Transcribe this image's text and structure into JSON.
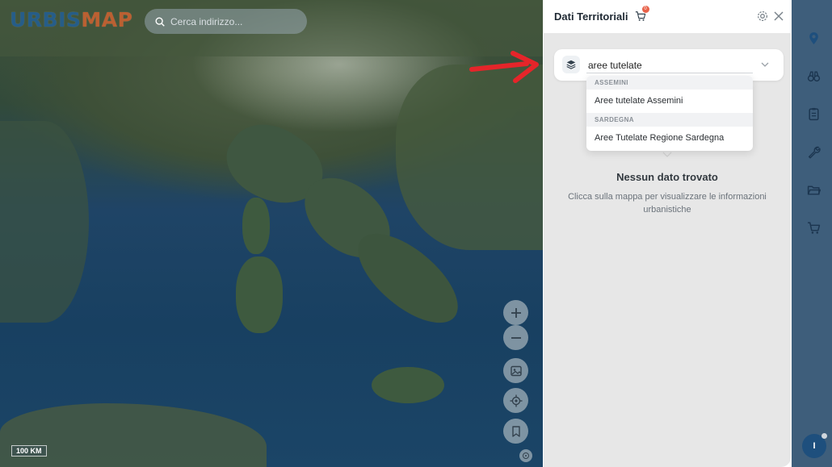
{
  "map": {
    "logo": {
      "text_a": "URBIS",
      "text_b": "MAP"
    },
    "search": {
      "placeholder": "Cerca indirizzo..."
    },
    "scale_label": "100 KM",
    "controls": [
      {
        "name": "zoom-in-button",
        "icon": "plus-icon"
      },
      {
        "name": "zoom-out-button",
        "icon": "minus-icon"
      },
      {
        "name": "basemap-button",
        "icon": "image-icon"
      },
      {
        "name": "locate-button",
        "icon": "crosshair-icon"
      },
      {
        "name": "bookmark-button",
        "icon": "bookmark-icon"
      }
    ]
  },
  "panel": {
    "title": "Dati Territoriali",
    "cart_badge": "0",
    "select": {
      "value": "aree tutelate"
    },
    "dropdown": {
      "groups": [
        {
          "header": "ASSEMINI",
          "options": [
            "Aree tutelate Assemini"
          ]
        },
        {
          "header": "SARDEGNA",
          "options": [
            "Aree Tutelate Regione Sardegna"
          ]
        }
      ]
    },
    "empty": {
      "title": "Nessun dato trovato",
      "description": "Clicca sulla mappa per visualizzare le informazioni urbanistiche"
    }
  },
  "rail": {
    "items": [
      "location-pin-icon",
      "binoculars-icon",
      "document-icon",
      "wrench-icon",
      "folder-icon",
      "cart-icon"
    ],
    "avatar_initial": "I"
  },
  "colors": {
    "accent": "#1e4f7d",
    "rail": "#3e5e7b",
    "panel_bg": "#e7e7e7",
    "arrow": "#e5252a",
    "badge": "#e8624a"
  }
}
